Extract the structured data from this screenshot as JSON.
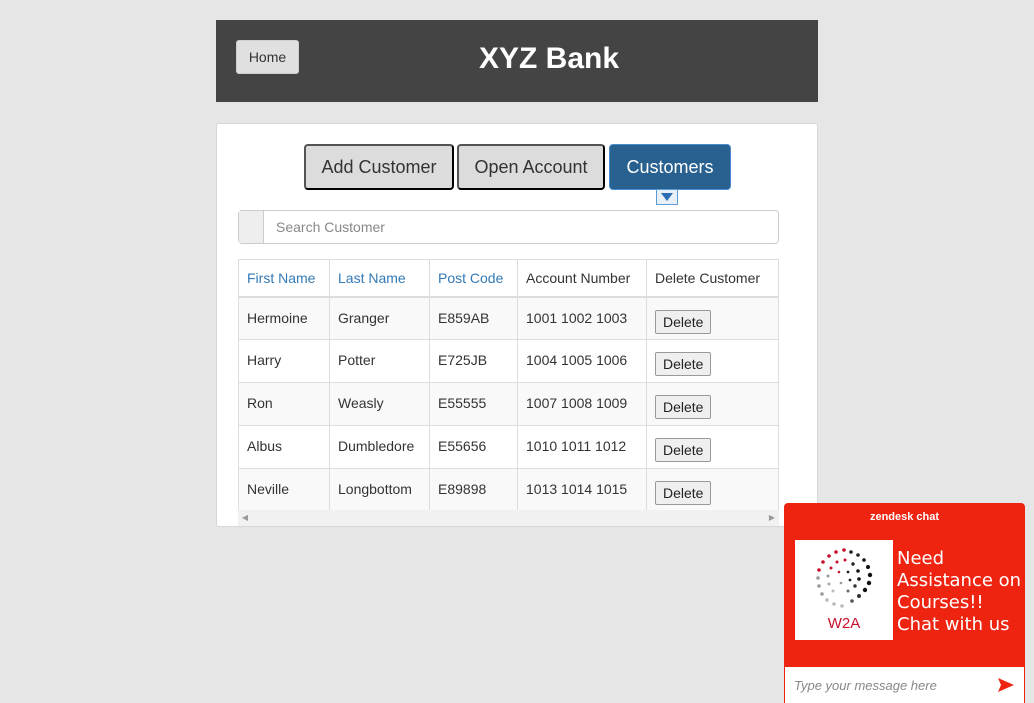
{
  "header": {
    "home_label": "Home",
    "brand": "XYZ Bank"
  },
  "tabs": [
    {
      "label": "Add Customer"
    },
    {
      "label": "Open Account"
    },
    {
      "label": "Customers",
      "active": true
    }
  ],
  "search": {
    "placeholder": "Search Customer",
    "value": ""
  },
  "table": {
    "columns": [
      "First Name",
      "Last Name",
      "Post Code",
      "Account Number",
      "Delete Customer"
    ],
    "rows": [
      {
        "first": "Hermoine",
        "last": "Granger",
        "post": "E859AB",
        "accounts": "1001 1002 1003",
        "action": "Delete"
      },
      {
        "first": "Harry",
        "last": "Potter",
        "post": "E725JB",
        "accounts": "1004 1005 1006",
        "action": "Delete"
      },
      {
        "first": "Ron",
        "last": "Weasly",
        "post": "E55555",
        "accounts": "1007 1008 1009",
        "action": "Delete"
      },
      {
        "first": "Albus",
        "last": "Dumbledore",
        "post": "E55656",
        "accounts": "1010 1011 1012",
        "action": "Delete"
      },
      {
        "first": "Neville",
        "last": "Longbottom",
        "post": "E89898",
        "accounts": "1013 1014 1015",
        "action": "Delete"
      }
    ]
  },
  "chat": {
    "title": "zendesk chat",
    "logo_text": "W2A",
    "message": "Need Assistance on Courses!! Chat with us",
    "input_placeholder": "Type your message here"
  },
  "colors": {
    "header_bg": "#444444",
    "active_tab": "#286090",
    "link": "#337ab7",
    "chat_bg": "#ee2411",
    "page_bg": "#e6e6e6"
  },
  "icons": {
    "tab_caret": "caret-down-icon",
    "send": "send-arrow-icon"
  }
}
